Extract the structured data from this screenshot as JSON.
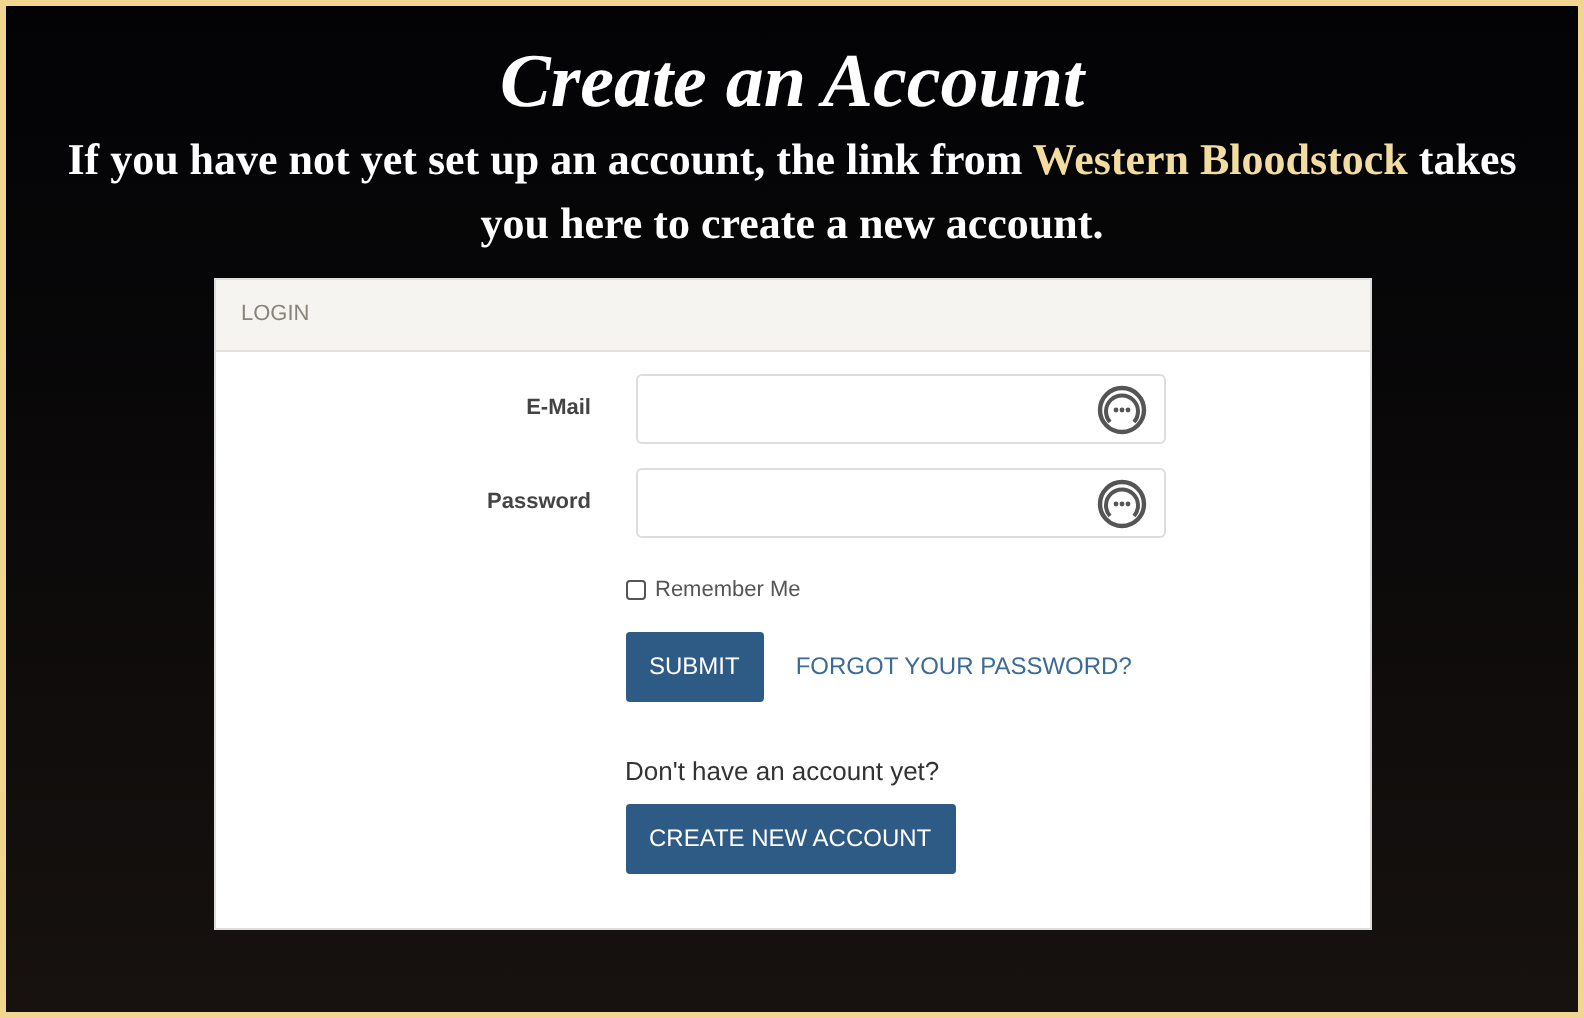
{
  "heading": {
    "title": "Create an Account",
    "intro": [
      {
        "kind": "plain",
        "text": "If you have not yet set up an account, the link from "
      },
      {
        "kind": "highlight",
        "text": "Western Bloodstock"
      },
      {
        "kind": "plain",
        "text": " takes you here to create a new account."
      }
    ]
  },
  "login_panel": {
    "header": "LOGIN",
    "fields": [
      {
        "label": "E-Mail"
      },
      {
        "label": "Password"
      }
    ],
    "remember_me": {
      "label": "Remember Me",
      "checked": false
    },
    "submit_button": "SUBMIT",
    "forgot_link": "FORGOT YOUR PASSWORD?",
    "signup_prompt": "Don't have an account yet?",
    "create_button": "CREATE NEW ACCOUNT"
  }
}
